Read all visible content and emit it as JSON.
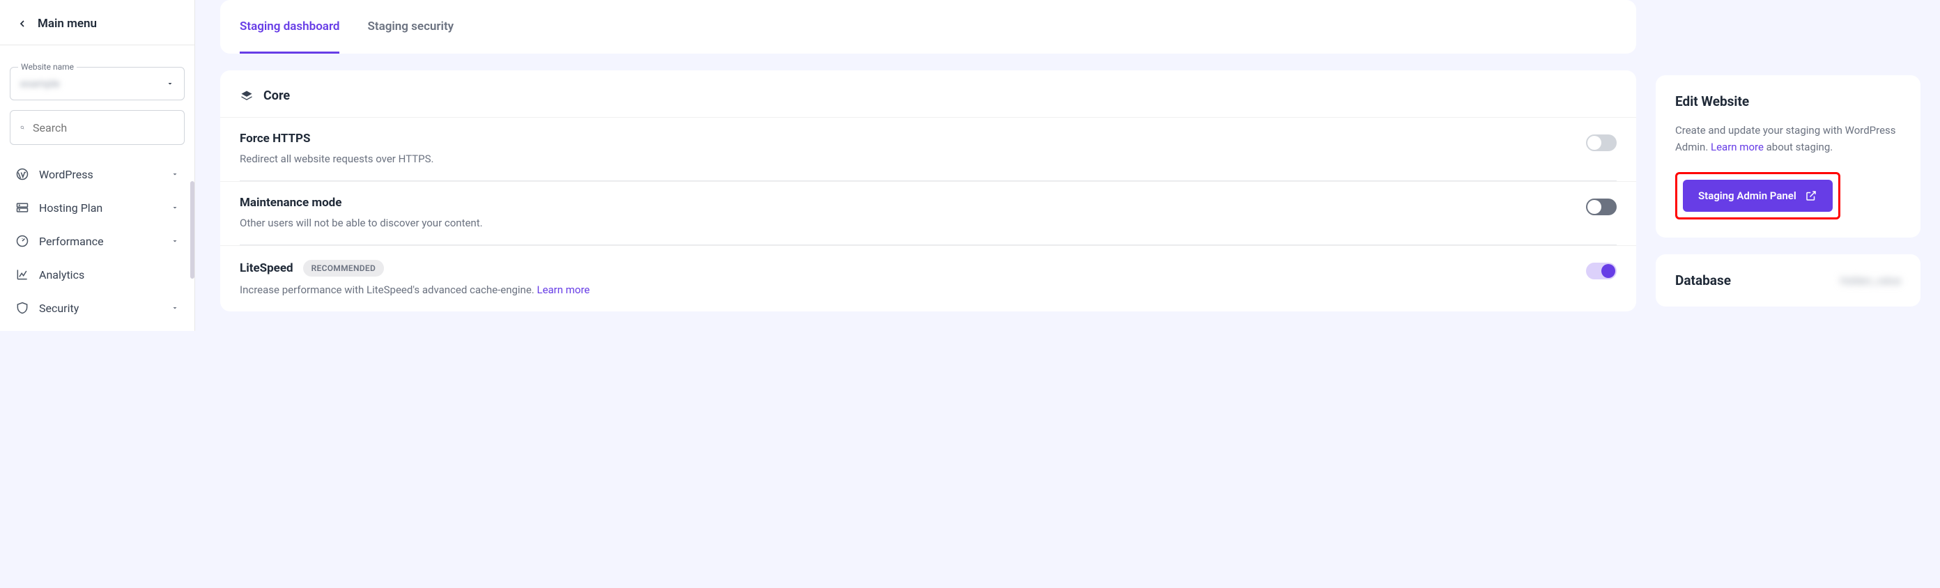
{
  "sidebar": {
    "main_menu_label": "Main menu",
    "website_name_label": "Website name",
    "website_name_value": "example",
    "search_placeholder": "Search",
    "items": [
      {
        "label": "WordPress",
        "has_chevron": true
      },
      {
        "label": "Hosting Plan",
        "has_chevron": true
      },
      {
        "label": "Performance",
        "has_chevron": true
      },
      {
        "label": "Analytics",
        "has_chevron": false
      },
      {
        "label": "Security",
        "has_chevron": true
      }
    ]
  },
  "tabs": [
    {
      "label": "Staging dashboard",
      "active": true
    },
    {
      "label": "Staging security",
      "active": false
    }
  ],
  "core": {
    "heading": "Core",
    "settings": [
      {
        "title": "Force HTTPS",
        "desc": "Redirect all website requests over HTTPS.",
        "badge": null,
        "learn_more": false,
        "state": "off"
      },
      {
        "title": "Maintenance mode",
        "desc": "Other users will not be able to discover your content.",
        "badge": null,
        "learn_more": false,
        "state": "off-dark"
      },
      {
        "title": "LiteSpeed",
        "desc": "Increase performance with LiteSpeed's advanced cache-engine. ",
        "badge": "RECOMMENDED",
        "learn_more": true,
        "state": "on"
      }
    ],
    "learn_more_label": "Learn more"
  },
  "edit_website": {
    "title": "Edit Website",
    "desc_part1": "Create and update your staging with WordPress Admin. ",
    "learn_more_label": "Learn more",
    "desc_part2": " about staging.",
    "button_label": "Staging Admin Panel"
  },
  "database": {
    "title": "Database",
    "value": "hidden_value"
  }
}
